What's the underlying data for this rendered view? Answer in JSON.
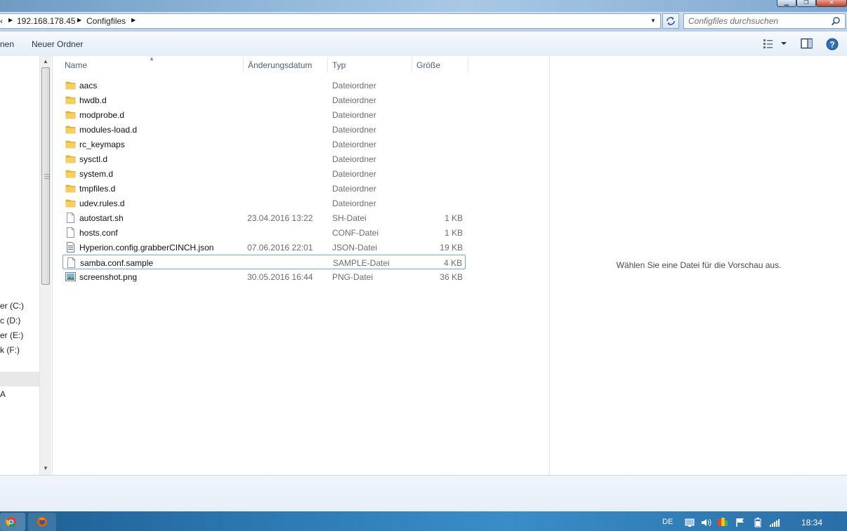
{
  "window": {
    "minimize_label": "▁",
    "maximize_label": "❐",
    "close_label": "✕"
  },
  "address": {
    "root_chevron": "‹",
    "crumbs": [
      "192.168.178.45",
      "Configfiles"
    ],
    "separator": "▶",
    "dropdown": "▼",
    "refresh_icon": "refresh-icon"
  },
  "search": {
    "placeholder": "Configfiles durchsuchen",
    "icon": "search-icon"
  },
  "toolbar": {
    "left_item": "nen",
    "new_folder": "Neuer Ordner",
    "view_icon": "view-options-icon",
    "preview_pane_icon": "preview-pane-icon",
    "help_icon": "help-icon"
  },
  "nav": {
    "drives": [
      "er (C:)",
      "c (D:)",
      "er (E:)",
      "k (F:)"
    ],
    "network_item": "A"
  },
  "columns": {
    "name": "Name",
    "date": "Änderungsdatum",
    "type": "Typ",
    "size": "Größe"
  },
  "files": [
    {
      "name": "aacs",
      "date": "",
      "type": "Dateiordner",
      "size": "",
      "icon": "folder"
    },
    {
      "name": "hwdb.d",
      "date": "",
      "type": "Dateiordner",
      "size": "",
      "icon": "folder"
    },
    {
      "name": "modprobe.d",
      "date": "",
      "type": "Dateiordner",
      "size": "",
      "icon": "folder"
    },
    {
      "name": "modules-load.d",
      "date": "",
      "type": "Dateiordner",
      "size": "",
      "icon": "folder"
    },
    {
      "name": "rc_keymaps",
      "date": "",
      "type": "Dateiordner",
      "size": "",
      "icon": "folder"
    },
    {
      "name": "sysctl.d",
      "date": "",
      "type": "Dateiordner",
      "size": "",
      "icon": "folder"
    },
    {
      "name": "system.d",
      "date": "",
      "type": "Dateiordner",
      "size": "",
      "icon": "folder"
    },
    {
      "name": "tmpfiles.d",
      "date": "",
      "type": "Dateiordner",
      "size": "",
      "icon": "folder"
    },
    {
      "name": "udev.rules.d",
      "date": "",
      "type": "Dateiordner",
      "size": "",
      "icon": "folder"
    },
    {
      "name": "autostart.sh",
      "date": "23.04.2016 13:22",
      "type": "SH-Datei",
      "size": "1 KB",
      "icon": "file"
    },
    {
      "name": "hosts.conf",
      "date": "",
      "type": "CONF-Datei",
      "size": "1 KB",
      "icon": "file"
    },
    {
      "name": "Hyperion.config.grabberCINCH.json",
      "date": "07.06.2016 22:01",
      "type": "JSON-Datei",
      "size": "19 KB",
      "icon": "json"
    },
    {
      "name": "samba.conf.sample",
      "date": "",
      "type": "SAMPLE-Datei",
      "size": "4 KB",
      "icon": "file",
      "selected": true
    },
    {
      "name": "screenshot.png",
      "date": "30.05.2016 16:44",
      "type": "PNG-Datei",
      "size": "36 KB",
      "icon": "image"
    }
  ],
  "preview": {
    "message": "Wählen Sie eine Datei für die Vorschau aus."
  },
  "tray": {
    "language": "DE",
    "time": "18:34"
  },
  "colors": {
    "folder": "#e8b82e",
    "selection_border": "#7da2ce",
    "taskbar": "#2e7cb6"
  }
}
